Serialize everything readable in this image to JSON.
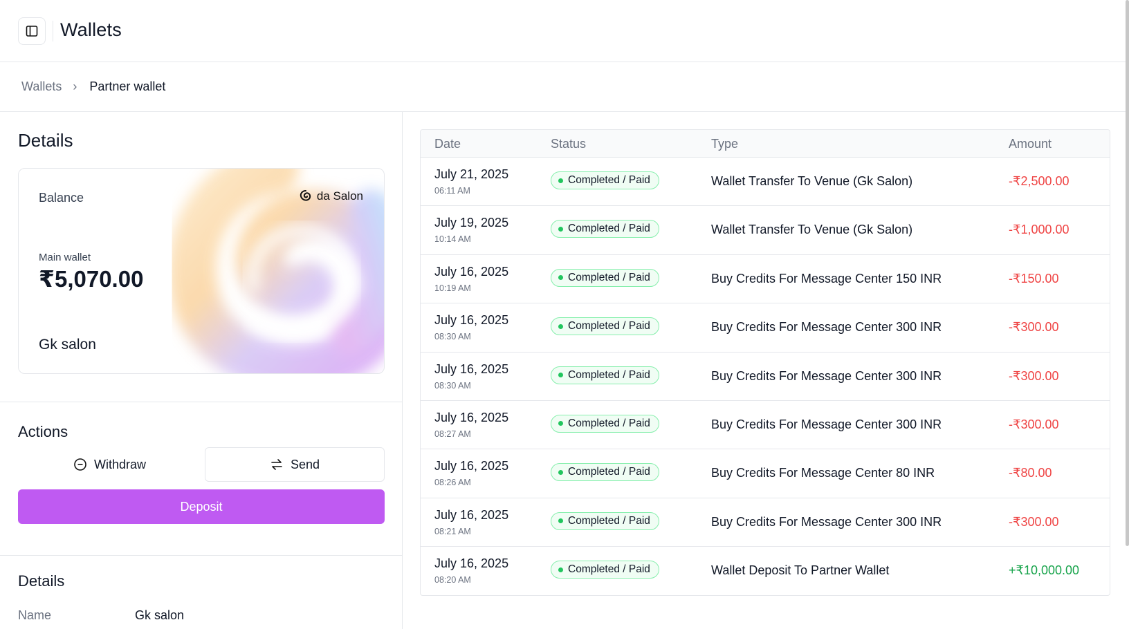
{
  "header": {
    "title": "Wallets"
  },
  "breadcrumb": {
    "root": "Wallets",
    "current": "Partner wallet"
  },
  "details": {
    "title": "Details",
    "card": {
      "balance_label": "Balance",
      "brand": "da Salon",
      "wallet_label": "Main wallet",
      "amount": "₹5,070.00",
      "holder": "Gk salon"
    }
  },
  "actions": {
    "title": "Actions",
    "withdraw_label": "Withdraw",
    "send_label": "Send",
    "deposit_label": "Deposit"
  },
  "details_info": {
    "title": "Details",
    "name_label": "Name",
    "name_value": "Gk salon"
  },
  "table": {
    "columns": {
      "date": "Date",
      "status": "Status",
      "type": "Type",
      "amount": "Amount"
    },
    "rows": [
      {
        "date": "July 21, 2025",
        "time": "06:11 AM",
        "status": "Completed / Paid",
        "type": "Wallet Transfer To Venue (Gk Salon)",
        "amount": "-₹2,500.00",
        "sign": "neg"
      },
      {
        "date": "July 19, 2025",
        "time": "10:14 AM",
        "status": "Completed / Paid",
        "type": "Wallet Transfer To Venue (Gk Salon)",
        "amount": "-₹1,000.00",
        "sign": "neg"
      },
      {
        "date": "July 16, 2025",
        "time": "10:19 AM",
        "status": "Completed / Paid",
        "type": "Buy Credits For Message Center 150 INR",
        "amount": "-₹150.00",
        "sign": "neg"
      },
      {
        "date": "July 16, 2025",
        "time": "08:30 AM",
        "status": "Completed / Paid",
        "type": "Buy Credits For Message Center 300 INR",
        "amount": "-₹300.00",
        "sign": "neg"
      },
      {
        "date": "July 16, 2025",
        "time": "08:30 AM",
        "status": "Completed / Paid",
        "type": "Buy Credits For Message Center 300 INR",
        "amount": "-₹300.00",
        "sign": "neg"
      },
      {
        "date": "July 16, 2025",
        "time": "08:27 AM",
        "status": "Completed / Paid",
        "type": "Buy Credits For Message Center 300 INR",
        "amount": "-₹300.00",
        "sign": "neg"
      },
      {
        "date": "July 16, 2025",
        "time": "08:26 AM",
        "status": "Completed / Paid",
        "type": "Buy Credits For Message Center 80 INR",
        "amount": "-₹80.00",
        "sign": "neg"
      },
      {
        "date": "July 16, 2025",
        "time": "08:21 AM",
        "status": "Completed / Paid",
        "type": "Buy Credits For Message Center 300 INR",
        "amount": "-₹300.00",
        "sign": "neg"
      },
      {
        "date": "July 16, 2025",
        "time": "08:20 AM",
        "status": "Completed / Paid",
        "type": "Wallet Deposit To Partner Wallet",
        "amount": "+₹10,000.00",
        "sign": "pos"
      }
    ]
  },
  "colors": {
    "accent": "#bf5af2",
    "negative": "#ef4444",
    "positive": "#16a34a",
    "status_dot": "#22c55e"
  }
}
